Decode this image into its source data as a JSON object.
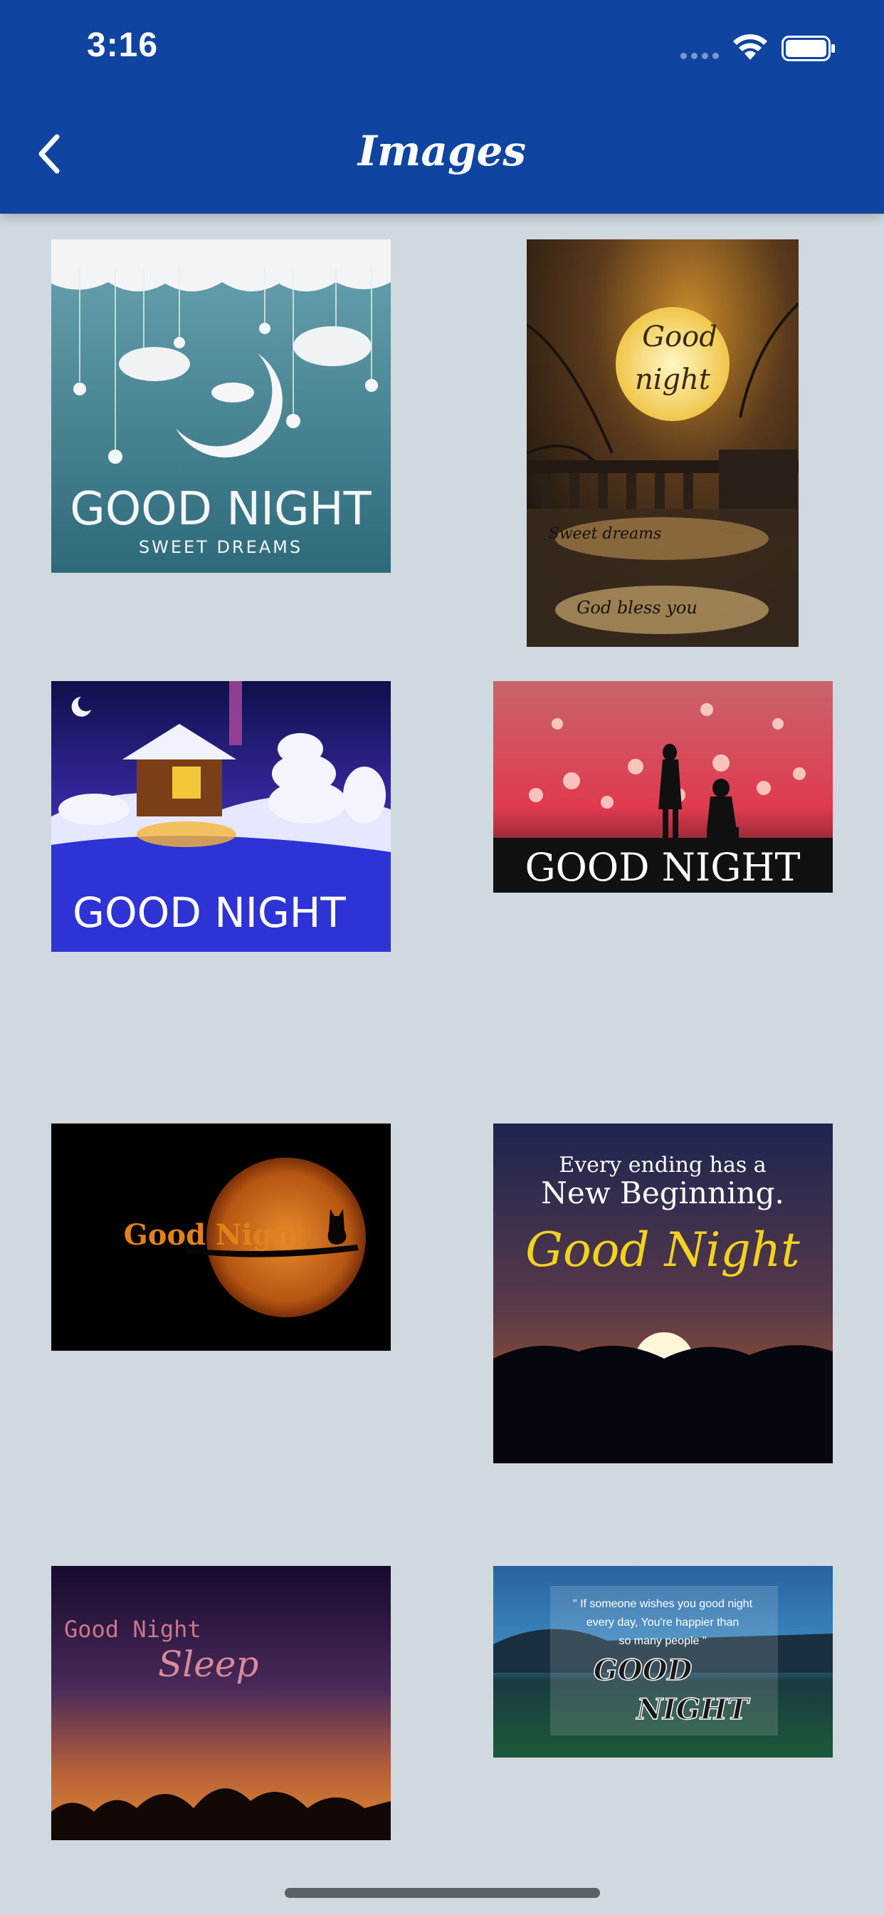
{
  "status": {
    "time": "3:16"
  },
  "header": {
    "title": "Images"
  },
  "images": [
    {
      "id": "img1",
      "line1": "GOOD NIGHT",
      "line2": "SWEET DREAMS"
    },
    {
      "id": "img2",
      "line1": "Good",
      "line2": "night",
      "line3": "Sweet dreams",
      "line4": "God bless you"
    },
    {
      "id": "img3",
      "line1": "GOOD NIGHT"
    },
    {
      "id": "img4",
      "line1": "GOOD NIGHT"
    },
    {
      "id": "img5",
      "line1": "Good Night"
    },
    {
      "id": "img6",
      "line1": "Every ending has a",
      "line2": "New Beginning.",
      "line3": "Good Night"
    },
    {
      "id": "img7",
      "line1": "Good Night",
      "line2": "Sleep"
    },
    {
      "id": "img8",
      "line1": "\" If someone wishes you good night",
      "line2": "every day, You're happier than",
      "line3": "so many people \"",
      "line4": "GOOD",
      "line5": "NIGHT"
    }
  ],
  "colors": {
    "header": "#0f44a1",
    "background": "#d0d9df"
  }
}
